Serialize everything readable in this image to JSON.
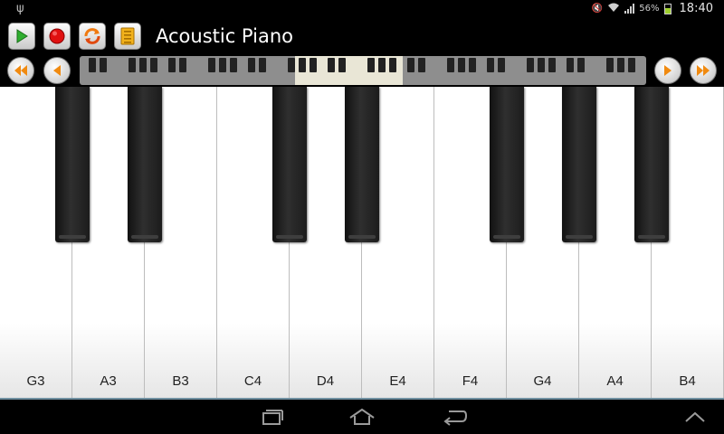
{
  "status_bar": {
    "battery_percent": "56%",
    "time": "18:40"
  },
  "toolbar": {
    "title": "Acoustic Piano",
    "play_color": "#2fae2f",
    "record_color": "#e01010",
    "loop_color": "#f07a10",
    "list_color": "#f2b21c"
  },
  "navigator": {
    "highlight_start_fraction": 0.38,
    "highlight_end_fraction": 0.57
  },
  "keyboard": {
    "white_keys": [
      "G3",
      "A3",
      "B3",
      "C4",
      "D4",
      "E4",
      "F4",
      "G4",
      "A4",
      "B4"
    ],
    "accent_color": "#6f8fa0"
  }
}
